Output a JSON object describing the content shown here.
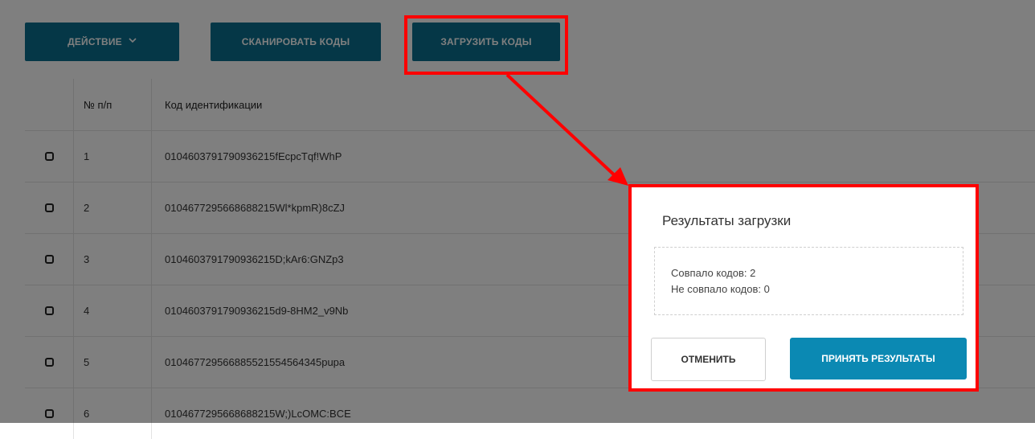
{
  "toolbar": {
    "action_label": "ДЕЙСТВИЕ",
    "action_icon": "chevron-down-icon",
    "scan_label": "СКАНИРОВАТЬ КОДЫ",
    "load_label": "ЗАГРУЗИТЬ КОДЫ"
  },
  "table": {
    "headers": {
      "num": "№ п/п",
      "code": "Код идентификации"
    },
    "rows": [
      {
        "num": "1",
        "code": "010460379179093621 5fEcpcTqf!WhP"
      },
      {
        "num": "2",
        "code": "0104677295668688215Wl*kpmR)8cZJ"
      },
      {
        "num": "3",
        "code": "0104603791790936215D;kAr6:GNZp3"
      },
      {
        "num": "4",
        "code": "0104603791790936215d9-8HM2_v9Nb"
      },
      {
        "num": "5",
        "code": "0104677295668855215545643 45pupa"
      },
      {
        "num": "6",
        "code": "0104677295668688215W;)LcOMC:BCE"
      }
    ]
  },
  "dialog": {
    "title": "Результаты загрузки",
    "matched": "Совпало кодов: 2",
    "unmatched": "Не совпало кодов: 0",
    "cancel_label": "ОТМЕНИТЬ",
    "accept_label": "ПРИНЯТЬ РЕЗУЛЬТАТЫ"
  },
  "colors": {
    "primary": "#0b6e8e",
    "accent": "#0b89b3",
    "highlight": "#ff0000"
  }
}
